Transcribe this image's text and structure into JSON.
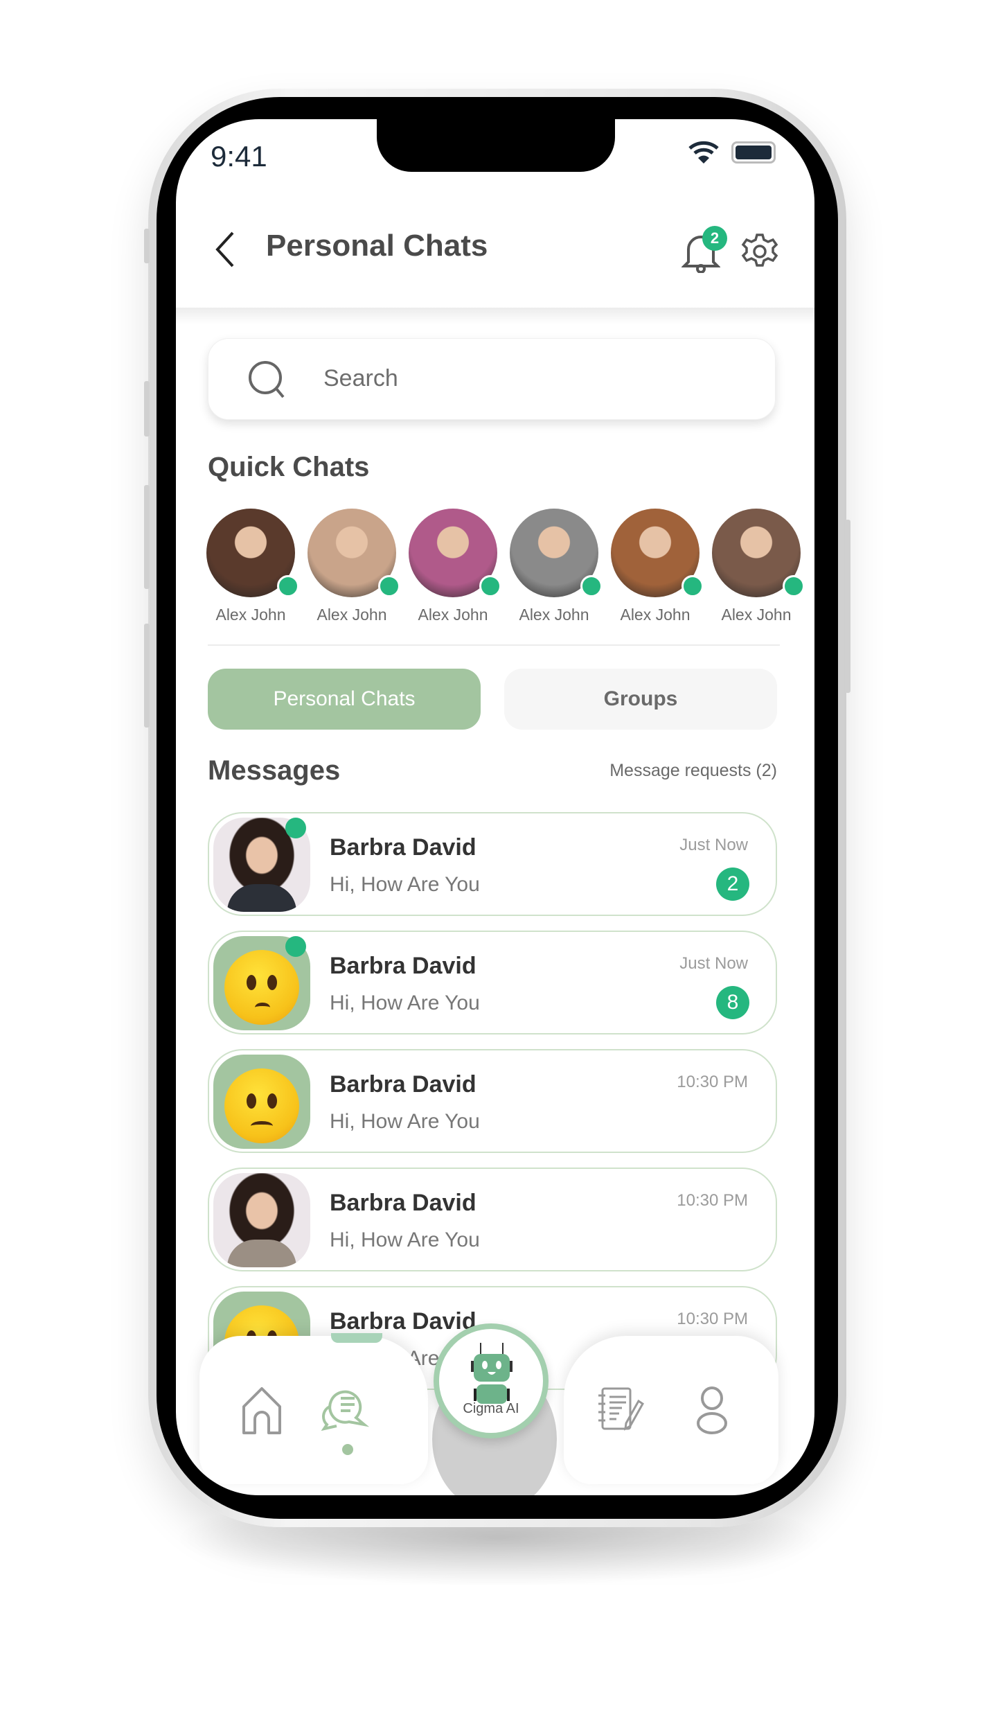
{
  "status_bar": {
    "time": "9:41"
  },
  "header": {
    "title": "Personal Chats",
    "notification_count": "2"
  },
  "search": {
    "placeholder": "Search"
  },
  "quick_chats": {
    "title": "Quick Chats",
    "contacts": [
      {
        "name": "Alex John",
        "color": "#5a3a2c"
      },
      {
        "name": "Alex John",
        "color": "#c9a48a"
      },
      {
        "name": "Alex John",
        "color": "#b05a8a"
      },
      {
        "name": "Alex John",
        "color": "#8a8a8a"
      },
      {
        "name": "Alex John",
        "color": "#a0623a"
      },
      {
        "name": "Alex John",
        "color": "#7a5a4a"
      }
    ]
  },
  "tabs": [
    {
      "label": "Personal Chats",
      "active": true
    },
    {
      "label": "Groups",
      "active": false
    }
  ],
  "messages": {
    "title": "Messages",
    "requests": "Message requests (2)",
    "items": [
      {
        "name": "Barbra David",
        "preview": "Hi, How Are You",
        "time": "Just Now",
        "unread": "2",
        "online": true,
        "avatar": "photo-woman"
      },
      {
        "name": "Barbra David",
        "preview": "Hi, How Are You",
        "time": "Just Now",
        "unread": "8",
        "online": true,
        "avatar": "emoji-worried"
      },
      {
        "name": "Barbra David",
        "preview": "Hi, How Are You",
        "time": "10:30 PM",
        "online": false,
        "avatar": "emoji-sad"
      },
      {
        "name": "Barbra David",
        "preview": "Hi, How Are You",
        "time": "10:30 PM",
        "online": false,
        "avatar": "photo-woman-2"
      },
      {
        "name": "Barbra David",
        "preview": "Hi, How Are You",
        "time": "10:30 PM",
        "online": false,
        "avatar": "emoji-worried"
      }
    ]
  },
  "bottom_nav": {
    "ai_label": "Cigma AI",
    "items": [
      "home",
      "chats",
      "ai",
      "notes",
      "profile"
    ],
    "active": "chats"
  },
  "colors": {
    "accent": "#a3c5a0",
    "online": "#25b77f"
  }
}
